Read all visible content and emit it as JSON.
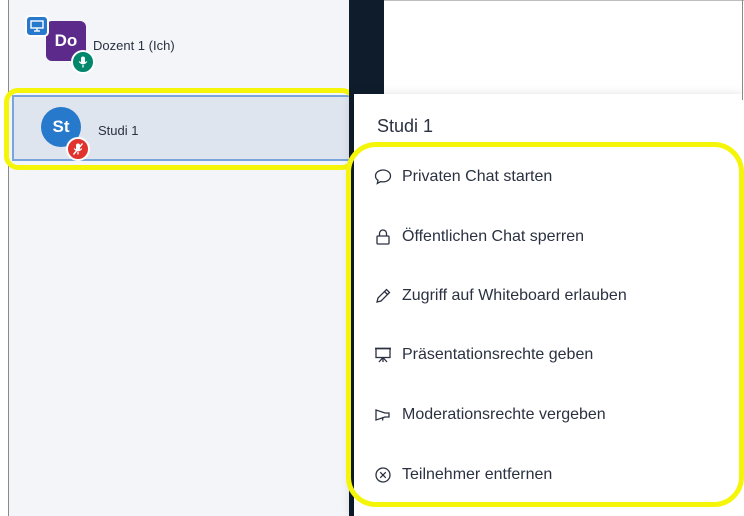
{
  "participants": [
    {
      "initials": "Do",
      "name": "Dozent 1 (Ich)",
      "role": "presenter",
      "avatar_color": "#5b2a8a",
      "audio": "on",
      "badge_icon": "presentation-icon"
    },
    {
      "initials": "St",
      "name": "Studi 1",
      "role": "student",
      "avatar_color": "#2779cc",
      "audio": "muted",
      "selected": true
    }
  ],
  "context_menu": {
    "title": "Studi 1",
    "items": [
      {
        "label": "Privaten Chat starten",
        "icon": "chat-bubble-icon"
      },
      {
        "label": "Öffentlichen Chat sperren",
        "icon": "lock-icon"
      },
      {
        "label": "Zugriff auf Whiteboard erlauben",
        "icon": "pencil-icon"
      },
      {
        "label": "Präsentationsrechte geben",
        "icon": "presentation-icon"
      },
      {
        "label": "Moderationsrechte vergeben",
        "icon": "megaphone-icon"
      },
      {
        "label": "Teilnehmer entfernen",
        "icon": "remove-circle-icon"
      }
    ]
  },
  "colors": {
    "highlight": "#f5f50a",
    "selected_row": "#dfe5ee",
    "audio_on": "#00876c",
    "audio_muted": "#e0332d",
    "dark_band": "#0e1c2c"
  }
}
